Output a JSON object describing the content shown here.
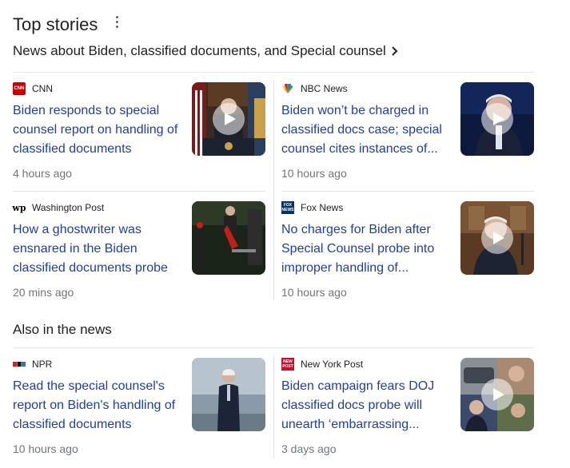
{
  "header": {
    "title": "Top stories"
  },
  "subtitle": "News about Biden, classified documents, and Special counsel",
  "top_stories": [
    {
      "source": "CNN",
      "headline": "Biden responds to special counsel report on handling of classified documents",
      "time": "4 hours ago",
      "video": true,
      "logo": "cnn-logo"
    },
    {
      "source": "NBC News",
      "headline": "Biden won’t be charged in classified docs case; special counsel cites instances of...",
      "time": "10 hours ago",
      "video": true,
      "logo": "nbc-peacock-logo"
    },
    {
      "source": "Washington Post",
      "headline": "How a ghostwriter was ensnared in the Biden classified documents probe",
      "time": "20 mins ago",
      "video": false,
      "logo": "wp-logo"
    },
    {
      "source": "Fox News",
      "headline": "No charges for Biden after Special Counsel probe into improper handling of...",
      "time": "10 hours ago",
      "video": true,
      "logo": "fox-news-logo"
    }
  ],
  "also_title": "Also in the news",
  "also_stories": [
    {
      "source": "NPR",
      "headline": "Read the special counsel's report on Biden's handling of classified documents",
      "time": "10 hours ago",
      "video": false,
      "logo": "npr-logo"
    },
    {
      "source": "New York Post",
      "headline": "Biden campaign fears DOJ classified docs probe will unearth ‘embarrassing...",
      "time": "3 days ago",
      "video": true,
      "logo": "ny-post-logo"
    }
  ],
  "colors": {
    "headline": "#1f3ea6",
    "time": "#70757a",
    "cnn": "#cc0000",
    "fox": "#003366",
    "nypost": "#c8102e"
  }
}
